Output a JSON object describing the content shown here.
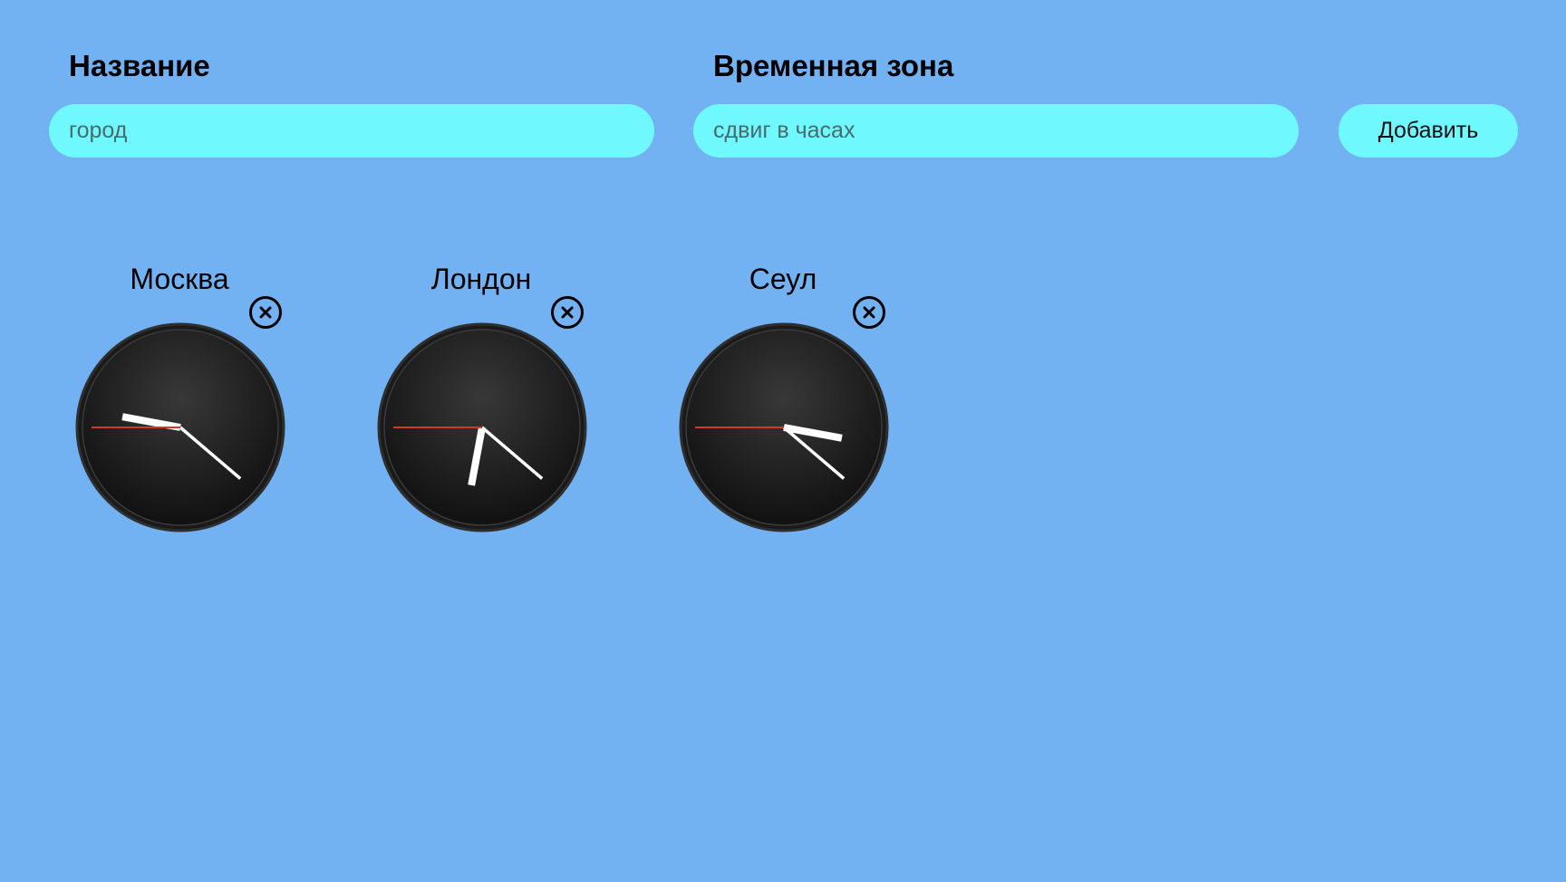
{
  "form": {
    "name_label": "Название",
    "name_placeholder": "город",
    "name_value": "",
    "zone_label": "Временная зона",
    "zone_placeholder": "сдвиг в часах",
    "zone_value": "",
    "add_button_label": "Добавить"
  },
  "colors": {
    "background": "#72b2f3",
    "field": "#6ff8fd",
    "second_hand": "#d23a22",
    "hands": "#ffffff",
    "dial": "#1a1a1a"
  },
  "icons": {
    "remove": "close-circle-icon"
  },
  "clocks": [
    {
      "city": "Москва",
      "time": {
        "hours": 9,
        "minutes": 21,
        "seconds": 45
      }
    },
    {
      "city": "Лондон",
      "time": {
        "hours": 6,
        "minutes": 21,
        "seconds": 45
      }
    },
    {
      "city": "Сеул",
      "time": {
        "hours": 3,
        "minutes": 21,
        "seconds": 45
      }
    }
  ]
}
